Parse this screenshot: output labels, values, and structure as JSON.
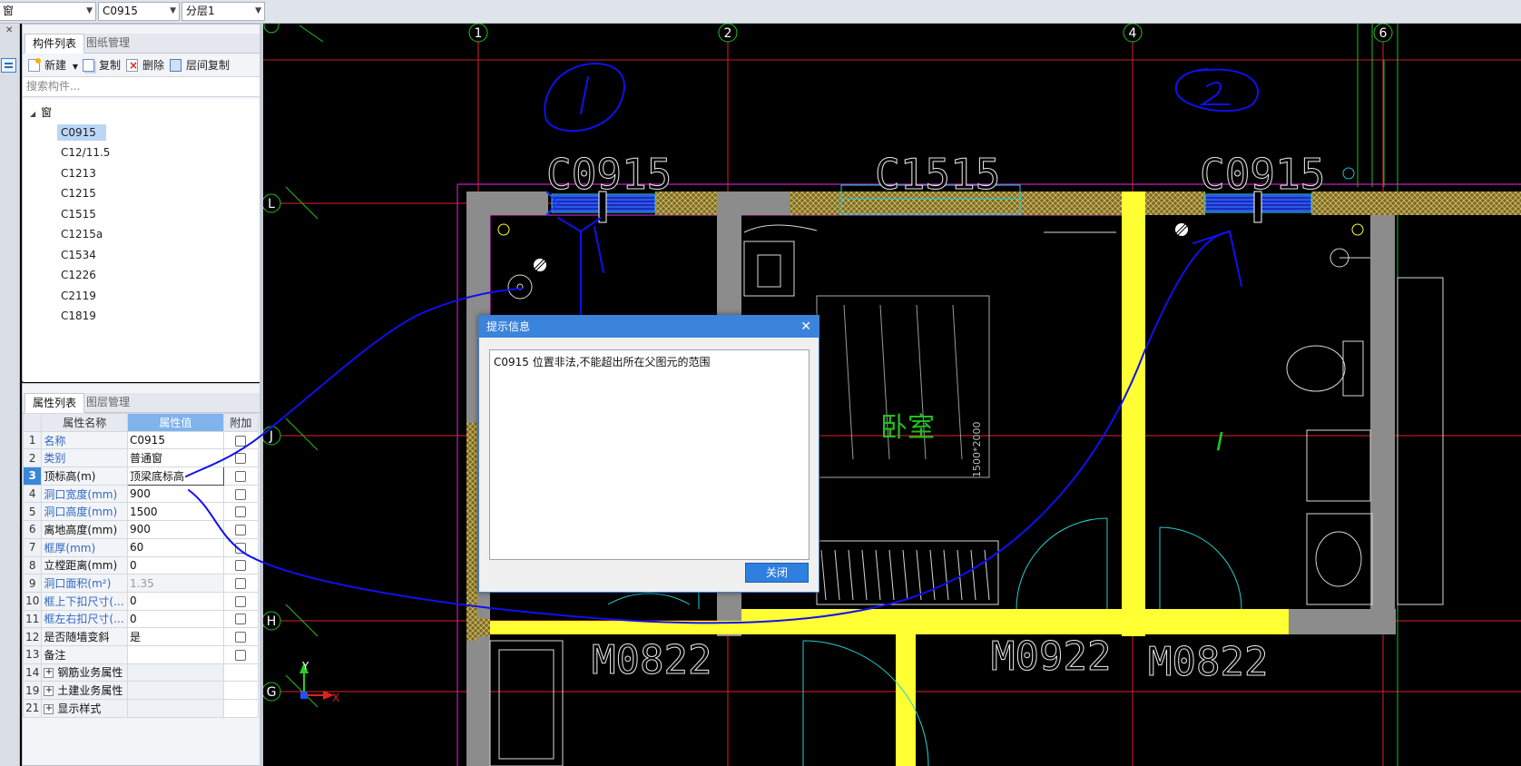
{
  "topbar": {
    "combo1": "窗",
    "combo2": "C0915",
    "combo3": "分层1"
  },
  "component_panel": {
    "tabs": [
      "构件列表",
      "图纸管理"
    ],
    "toolbar": {
      "new_label": "新建",
      "copy_label": "复制",
      "delete_label": "删除",
      "floor_copy_label": "层间复制"
    },
    "search_placeholder": "搜索构件...",
    "tree_root": "窗",
    "items": [
      "C0915",
      "C12/11.5",
      "C1213",
      "C1215",
      "C1515",
      "C1215a",
      "C1534",
      "C1226",
      "C2119",
      "C1819"
    ],
    "selected": "C0915"
  },
  "property_panel": {
    "tabs": [
      "属性列表",
      "图层管理"
    ],
    "headers": [
      "属性名称",
      "属性值",
      "附加"
    ],
    "rows": [
      {
        "num": "1",
        "name": "名称",
        "value": "C0915",
        "blue": true
      },
      {
        "num": "2",
        "name": "类别",
        "value": "普通窗",
        "blue": true
      },
      {
        "num": "3",
        "name": "顶标高(m)",
        "value": "顶梁底标高",
        "blue": false
      },
      {
        "num": "4",
        "name": "洞口宽度(mm)",
        "value": "900",
        "blue": true
      },
      {
        "num": "5",
        "name": "洞口高度(mm)",
        "value": "1500",
        "blue": true
      },
      {
        "num": "6",
        "name": "离地高度(mm)",
        "value": "900",
        "blue": false
      },
      {
        "num": "7",
        "name": "框厚(mm)",
        "value": "60",
        "blue": true
      },
      {
        "num": "8",
        "name": "立樘距离(mm)",
        "value": "0",
        "blue": false
      },
      {
        "num": "9",
        "name": "洞口面积(m²)",
        "value": "1.35",
        "blue": true
      },
      {
        "num": "10",
        "name": "框上下扣尺寸(...",
        "value": "0",
        "blue": true
      },
      {
        "num": "11",
        "name": "框左右扣尺寸(...",
        "value": "0",
        "blue": true
      },
      {
        "num": "12",
        "name": "是否随墙变斜",
        "value": "是",
        "blue": false
      },
      {
        "num": "13",
        "name": "备注",
        "value": "",
        "blue": false
      }
    ],
    "groups": [
      {
        "num": "14",
        "name": "钢筋业务属性"
      },
      {
        "num": "19",
        "name": "土建业务属性"
      },
      {
        "num": "21",
        "name": "显示样式"
      }
    ]
  },
  "cad": {
    "axis_numbers": [
      "1",
      "2",
      "4",
      "6"
    ],
    "axis_letters": [
      "L",
      "J",
      "H",
      "G"
    ],
    "window_labels": [
      "C0915",
      "C1515",
      "C0915"
    ],
    "door_labels": [
      "M0822",
      "M0922",
      "M0822"
    ],
    "room_label": "卧室",
    "dim_text": "1500*2000",
    "ucs_x": "X",
    "ucs_y": "Y"
  },
  "dialog": {
    "title": "提示信息",
    "message": "C0915 位置非法,不能超出所在父图元的范围",
    "close_button": "关闭"
  },
  "colors": {
    "accent": "#3b84dc",
    "wall_yellow": "#ffff33",
    "axis_red": "#e0202e",
    "annotation_blue": "#1010ee"
  }
}
